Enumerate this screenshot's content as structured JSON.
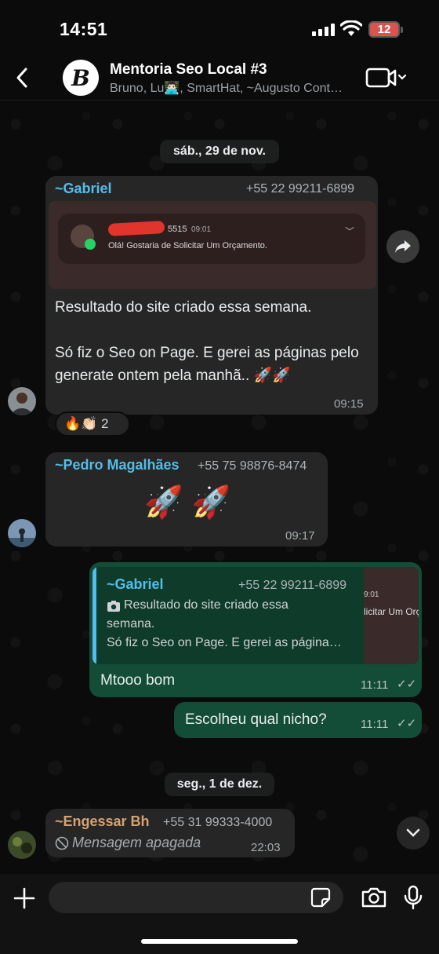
{
  "status_bar": {
    "time": "14:51",
    "battery": "12"
  },
  "header": {
    "back_icon": "chevron-left-icon",
    "group_avatar_letter": "B",
    "title": "Mentoria Seo Local #3",
    "members": "Bruno, Lu👨🏻‍💻, SmartHat, ~Augusto Cont…",
    "video_icon": "video-call-icon"
  },
  "dates": {
    "first": "sáb., 29 de nov.",
    "second": "seg., 1 de dez."
  },
  "messages": {
    "gabriel": {
      "sender": "~Gabriel",
      "phone": "+55 22 99211-6899",
      "screenshot": {
        "number": "5515",
        "time": "09:01",
        "text": "Olá! Gostaria de Solicitar Um Orçamento."
      },
      "text_1": "Resultado do site criado essa semana.",
      "text_2": "Só fiz o Seo on Page. E gerei as páginas pelo generate ontem pela manhã.. 🚀🚀",
      "time": "09:15",
      "reactions": "🔥👏🏻 2",
      "sender_color": "#53bdeb"
    },
    "pedro": {
      "sender": "~Pedro Magalhães",
      "phone": "+55 75 98876-8474",
      "text": "🚀 🚀",
      "time": "09:17",
      "sender_color": "#53bdeb"
    },
    "reply_1": {
      "quote_sender": "~Gabriel",
      "quote_phone": "+55 22 99211-6899",
      "quote_text_1": "Resultado do site criado essa",
      "quote_text_2": "semana.",
      "quote_text_3": "Só fiz o Seo on Page. E gerei as página…",
      "thumb_time": "9:01",
      "thumb_text": "licitar Um Orça",
      "text": "Mtooo bom",
      "time": "11:11",
      "ticks": "✓✓"
    },
    "reply_2": {
      "text": "Escolheu qual nicho?",
      "time": "11:11",
      "ticks": "✓✓"
    },
    "engessar": {
      "sender": "~Engessar Bh",
      "phone": "+55 31 99333-4000",
      "text": "Mensagem apagada",
      "time": "22:03",
      "sender_color": "#d4a373"
    }
  },
  "input": {
    "placeholder": ""
  },
  "colors": {
    "accent": "#53bdeb",
    "outgoing_bubble": "#134d37",
    "incoming_bubble": "#262626"
  }
}
